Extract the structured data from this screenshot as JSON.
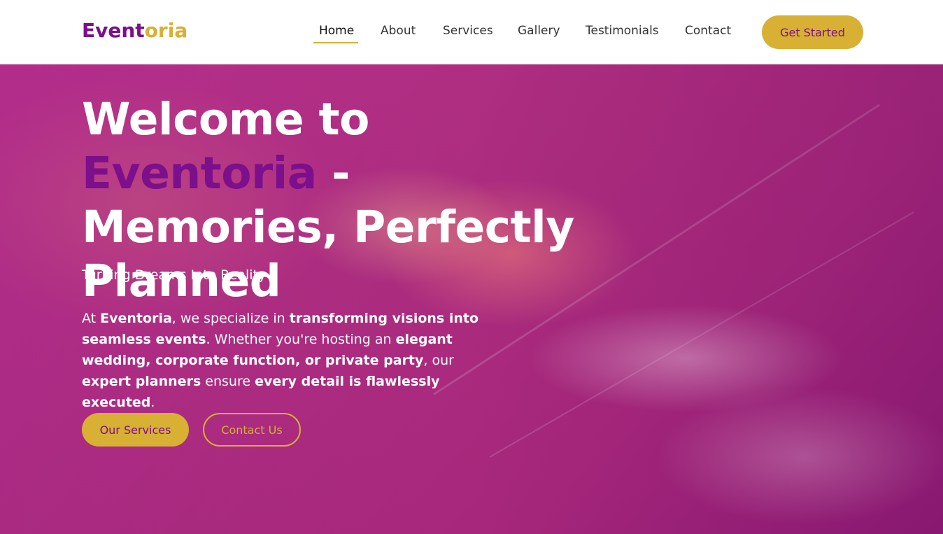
{
  "brand": {
    "name_part1": "Event",
    "name_part2": "oria"
  },
  "nav": {
    "items": [
      {
        "label": "Home",
        "active": true
      },
      {
        "label": "About"
      },
      {
        "label": "Services"
      },
      {
        "label": "Gallery"
      },
      {
        "label": "Testimonials"
      },
      {
        "label": "Contact"
      }
    ],
    "cta_label": "Get Started"
  },
  "hero": {
    "title_prefix": "Welcome to ",
    "title_brand": "Eventoria",
    "title_suffix": " - Memories, Perfectly Planned",
    "tagline": "Turning Dreams Into Reality",
    "desc": {
      "t1": "At ",
      "b1": "Eventoria",
      "t2": ", we specialize in ",
      "b2": "transforming visions into seamless events",
      "t3": ". Whether you're hosting an ",
      "b3": "elegant wedding, corporate function, or private party",
      "t4": ", our ",
      "b4": "expert planners",
      "t5": " ensure ",
      "b5": "every detail is flawlessly executed",
      "t6": "."
    },
    "primary_button": "Our Services",
    "secondary_button": "Contact Us"
  },
  "colors": {
    "brand_purple": "#7b0f8c",
    "brand_gold": "#d8b034",
    "overlay_magenta": "#b1307f"
  }
}
